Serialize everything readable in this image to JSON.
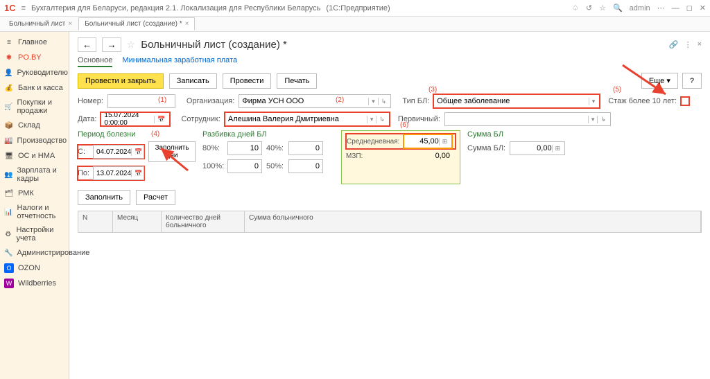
{
  "app": {
    "title": "Бухгалтерия для Беларуси, редакция 2.1. Локализация для Республики Беларусь",
    "mode": "(1С:Предприятие)",
    "user": "admin"
  },
  "tabs": [
    {
      "label": "Больничный лист"
    },
    {
      "label": "Больничный лист (создание) *"
    }
  ],
  "sidebar": [
    {
      "label": "Главное",
      "ico": "≡"
    },
    {
      "label": "PO.BY",
      "ico": "✱"
    },
    {
      "label": "Руководителю",
      "ico": "👤"
    },
    {
      "label": "Банк и касса",
      "ico": "💰"
    },
    {
      "label": "Покупки и продажи",
      "ico": "🛒"
    },
    {
      "label": "Склад",
      "ico": "📦"
    },
    {
      "label": "Производство",
      "ico": "🏭"
    },
    {
      "label": "ОС и НМА",
      "ico": "🖥"
    },
    {
      "label": "Зарплата и кадры",
      "ico": "👥"
    },
    {
      "label": "РМК",
      "ico": "🗂"
    },
    {
      "label": "Налоги и отчетность",
      "ico": "📊"
    },
    {
      "label": "Настройки учета",
      "ico": "⚙"
    },
    {
      "label": "Администрирование",
      "ico": "🔧"
    },
    {
      "label": "OZON",
      "ico": "O"
    },
    {
      "label": "Wildberries",
      "ico": "W"
    }
  ],
  "page": {
    "title": "Больничный лист (создание) *",
    "subtabs": {
      "main": "Основное",
      "mzp": "Минимальная заработная плата"
    }
  },
  "cmd": {
    "post_close": "Провести и закрыть",
    "save": "Записать",
    "post": "Провести",
    "print": "Печать",
    "more": "Еще",
    "help": "?"
  },
  "form": {
    "number_lbl": "Номер:",
    "number": "",
    "org_lbl": "Организация:",
    "org": "Фирма УСН ООО",
    "type_lbl": "Тип БЛ:",
    "type": "Общее заболевание",
    "exp_lbl": "Стаж более 10 лет:",
    "date_lbl": "Дата:",
    "date": "15.07.2024 0:00:00",
    "emp_lbl": "Сотрудник:",
    "emp": "Алешина Валерия Дмитриевна",
    "primary_lbl": "Первичный:",
    "primary": ""
  },
  "period": {
    "legend": "Период болезни",
    "from_lbl": "С:",
    "from": "04.07.2024",
    "to_lbl": "По:",
    "to": "13.07.2024",
    "fill_days": "Заполнить дни"
  },
  "split": {
    "legend": "Разбивка дней БЛ",
    "p80": "80%:",
    "v80": "10",
    "p40": "40%:",
    "v40": "0",
    "p100": "100%:",
    "v100": "0",
    "p50": "50%:",
    "v50": "0"
  },
  "avg": {
    "avg_lbl": "Среднедневная:",
    "avg": "45,00",
    "mzp_lbl": "МЗП:",
    "mzp": "0,00"
  },
  "sum": {
    "legend": "Сумма БЛ",
    "lbl": "Сумма БЛ:",
    "val": "0,00"
  },
  "actions": {
    "fill": "Заполнить",
    "calc": "Расчет"
  },
  "table": {
    "n": "N",
    "month": "Месяц",
    "days": "Количество дней больничного",
    "sum": "Сумма больничного"
  },
  "ann": {
    "a1": "(1)",
    "a2": "(2)",
    "a3": "(3)",
    "a4": "(4)",
    "a5": "(5)",
    "a6": "(6)"
  },
  "colors": {
    "red": "#e8412d",
    "green": "#2e7d32",
    "yellowBtn": "#ffe04d"
  }
}
